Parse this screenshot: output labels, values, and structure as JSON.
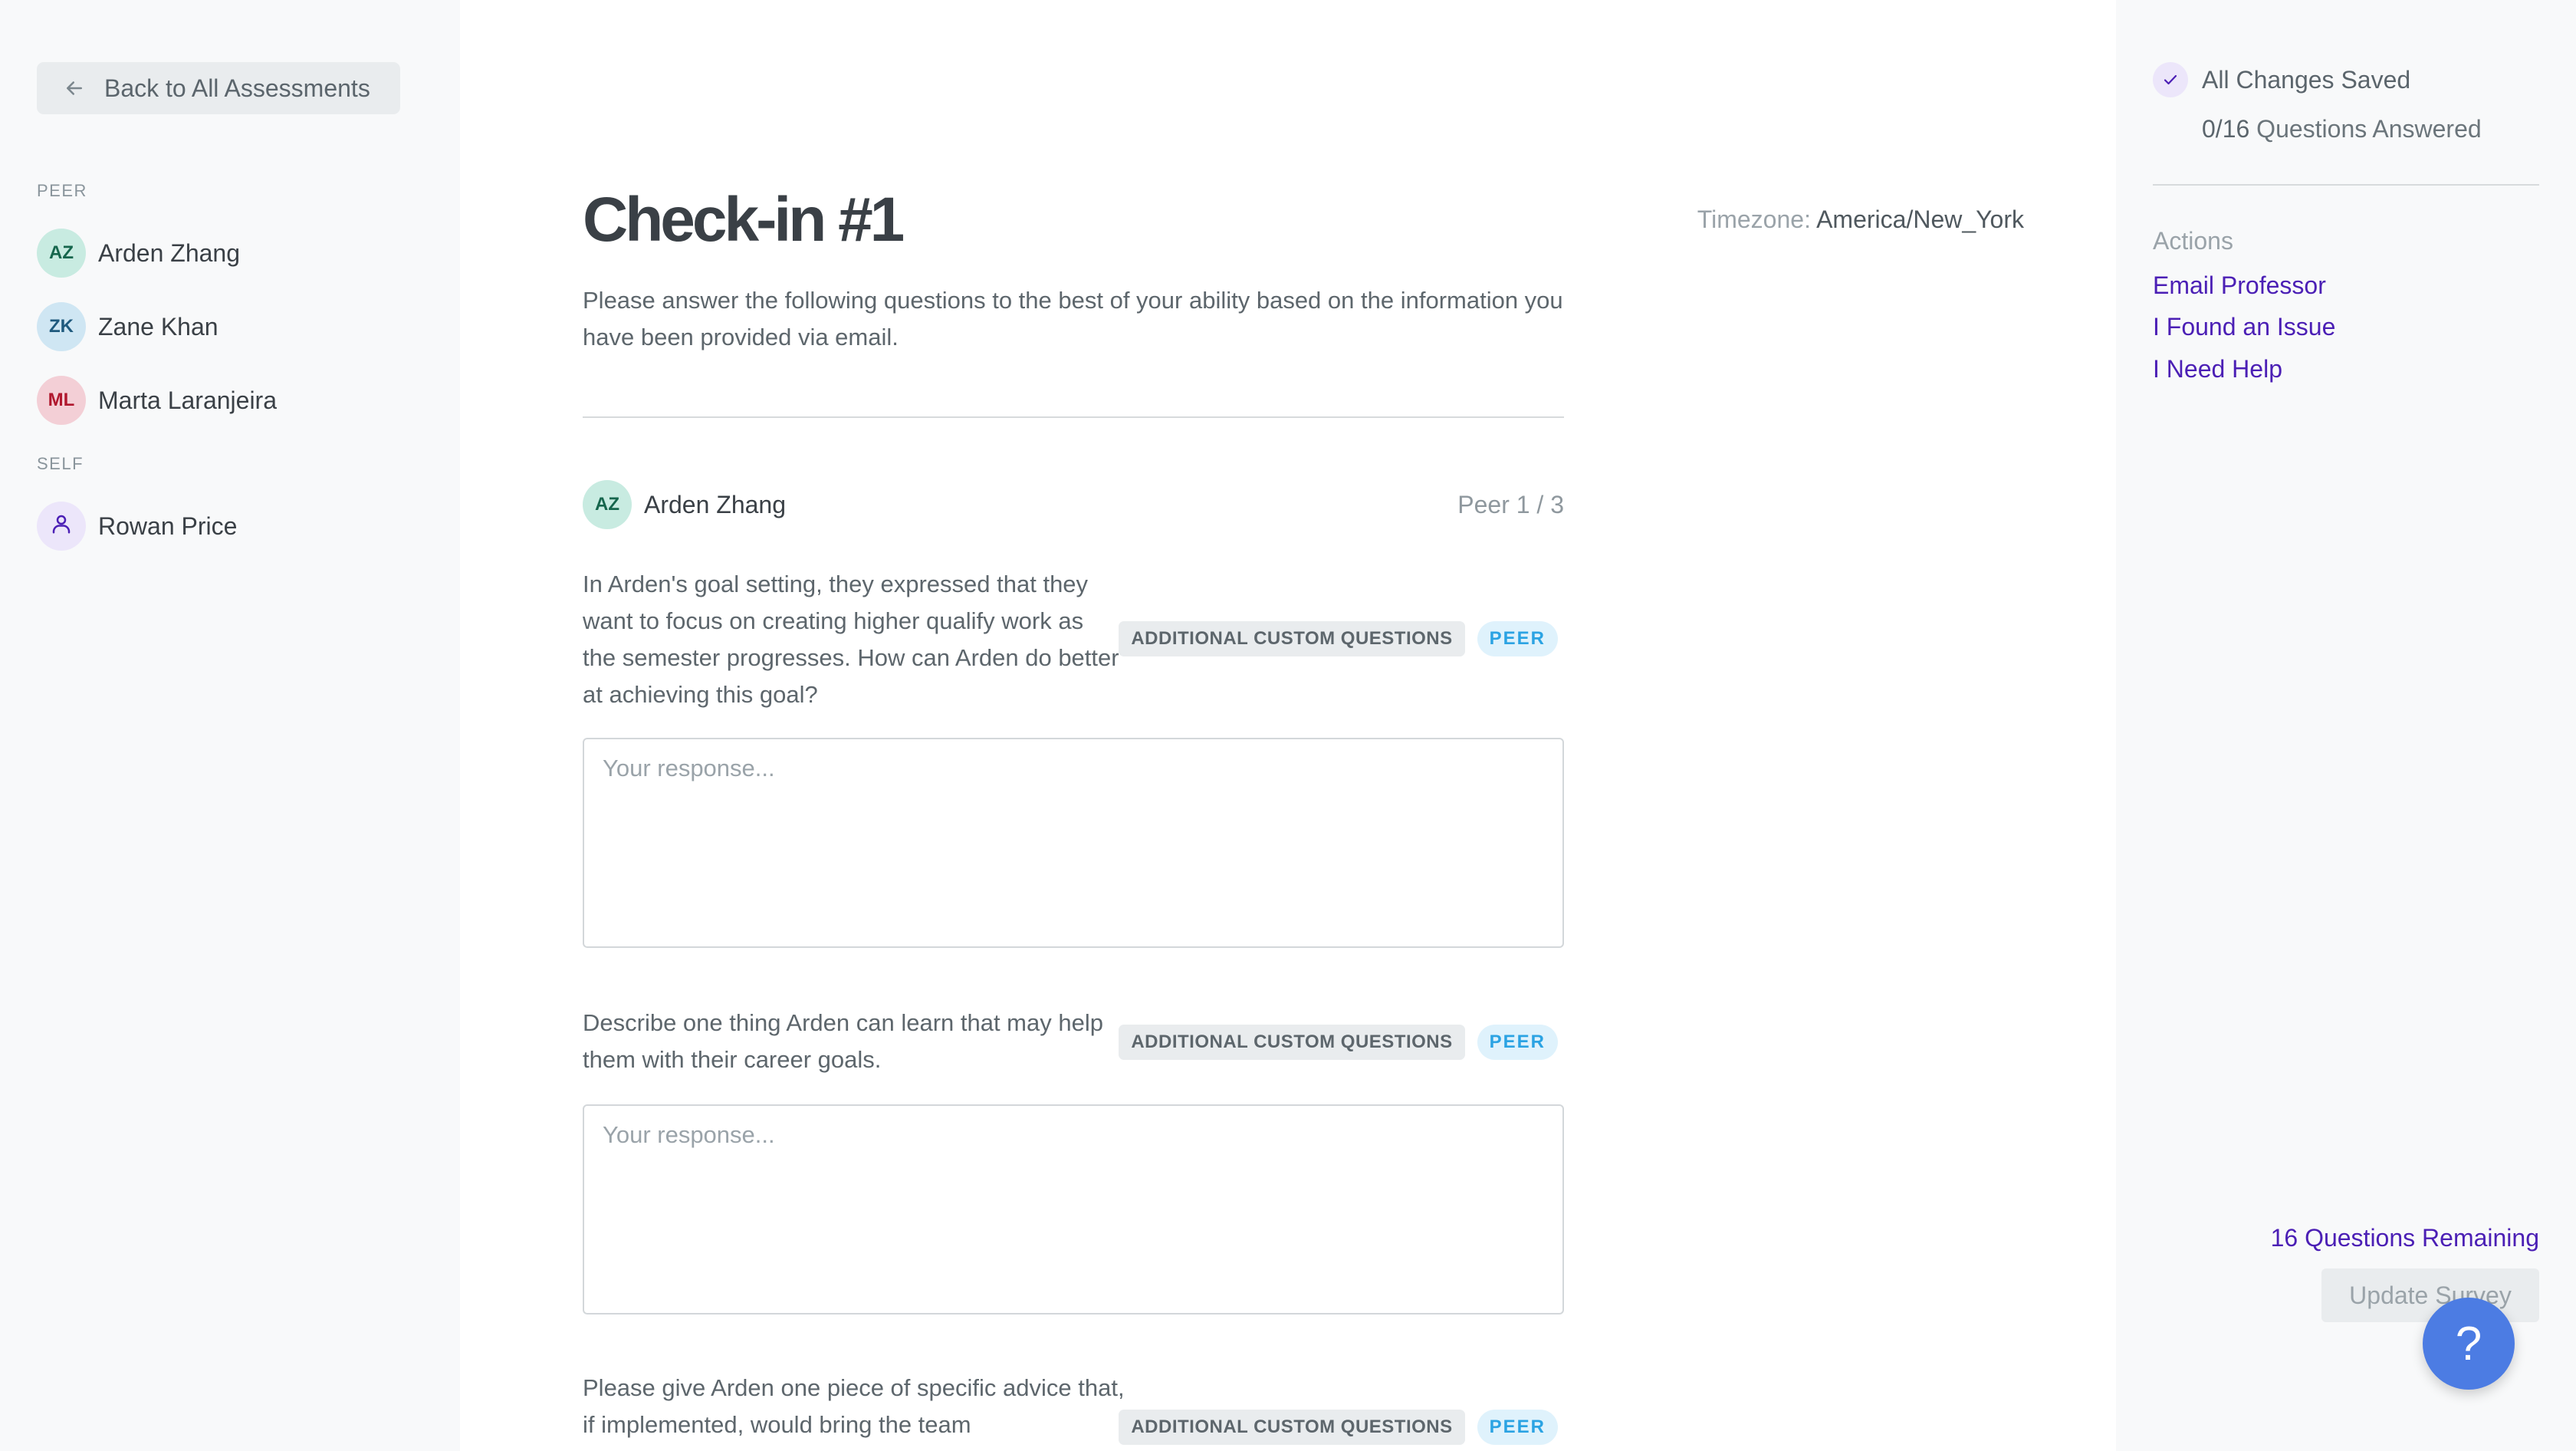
{
  "sidebar": {
    "back_label": "Back to All Assessments",
    "peer_section_label": "PEER",
    "self_section_label": "SELF",
    "peers": [
      {
        "initials": "AZ",
        "name": "Arden Zhang",
        "avatar_bg": "#c8ebe1",
        "avatar_fg": "#16664d"
      },
      {
        "initials": "ZK",
        "name": "Zane Khan",
        "avatar_bg": "#cfe6f3",
        "avatar_fg": "#1f5a7e"
      },
      {
        "initials": "ML",
        "name": "Marta Laranjeira",
        "avatar_bg": "#f3cfd6",
        "avatar_fg": "#b0172e"
      }
    ],
    "self": {
      "name": "Rowan Price",
      "icon": "user-icon",
      "avatar_bg": "#ece6fa",
      "avatar_fg": "#4b1fb5"
    }
  },
  "main": {
    "title": "Check-in #1",
    "timezone_label": "Timezone:",
    "timezone_value": "America/New_York",
    "intro": "Please answer the following questions to the best of your ability based on the information you have been provided via email.",
    "current_peer": {
      "initials": "AZ",
      "name": "Arden Zhang",
      "counter": "Peer 1 / 3"
    },
    "questions": [
      {
        "text": "In Arden's goal setting, they expressed that they want to focus on creating higher qualify work as the semester progresses. How can Arden do better at achieving this goal?",
        "category_tag": "ADDITIONAL CUSTOM QUESTIONS",
        "type_tag": "PEER",
        "response_value": "",
        "response_placeholder": "Your response..."
      },
      {
        "text": "Describe one thing Arden can learn that may help them with their career goals.",
        "category_tag": "ADDITIONAL CUSTOM QUESTIONS",
        "type_tag": "PEER",
        "response_value": "",
        "response_placeholder": "Your response..."
      },
      {
        "text": "Please give Arden one piece of specific advice that, if implemented, would bring the team",
        "category_tag": "ADDITIONAL CUSTOM QUESTIONS",
        "type_tag": "PEER"
      }
    ]
  },
  "status": {
    "saved_label": "All Changes Saved",
    "answered_count": "0/16",
    "answered_label": "Questions Answered",
    "actions_label": "Actions",
    "actions": [
      "Email Professor",
      "I Found an Issue",
      "I Need Help"
    ],
    "remaining_label": "16 Questions Remaining",
    "update_button": "Update Survey",
    "help_fab": "?"
  },
  "colors": {
    "accent": "#4b1fb5",
    "peer_tag": "#2ba3e3",
    "help_fab": "#4c7ce3"
  }
}
